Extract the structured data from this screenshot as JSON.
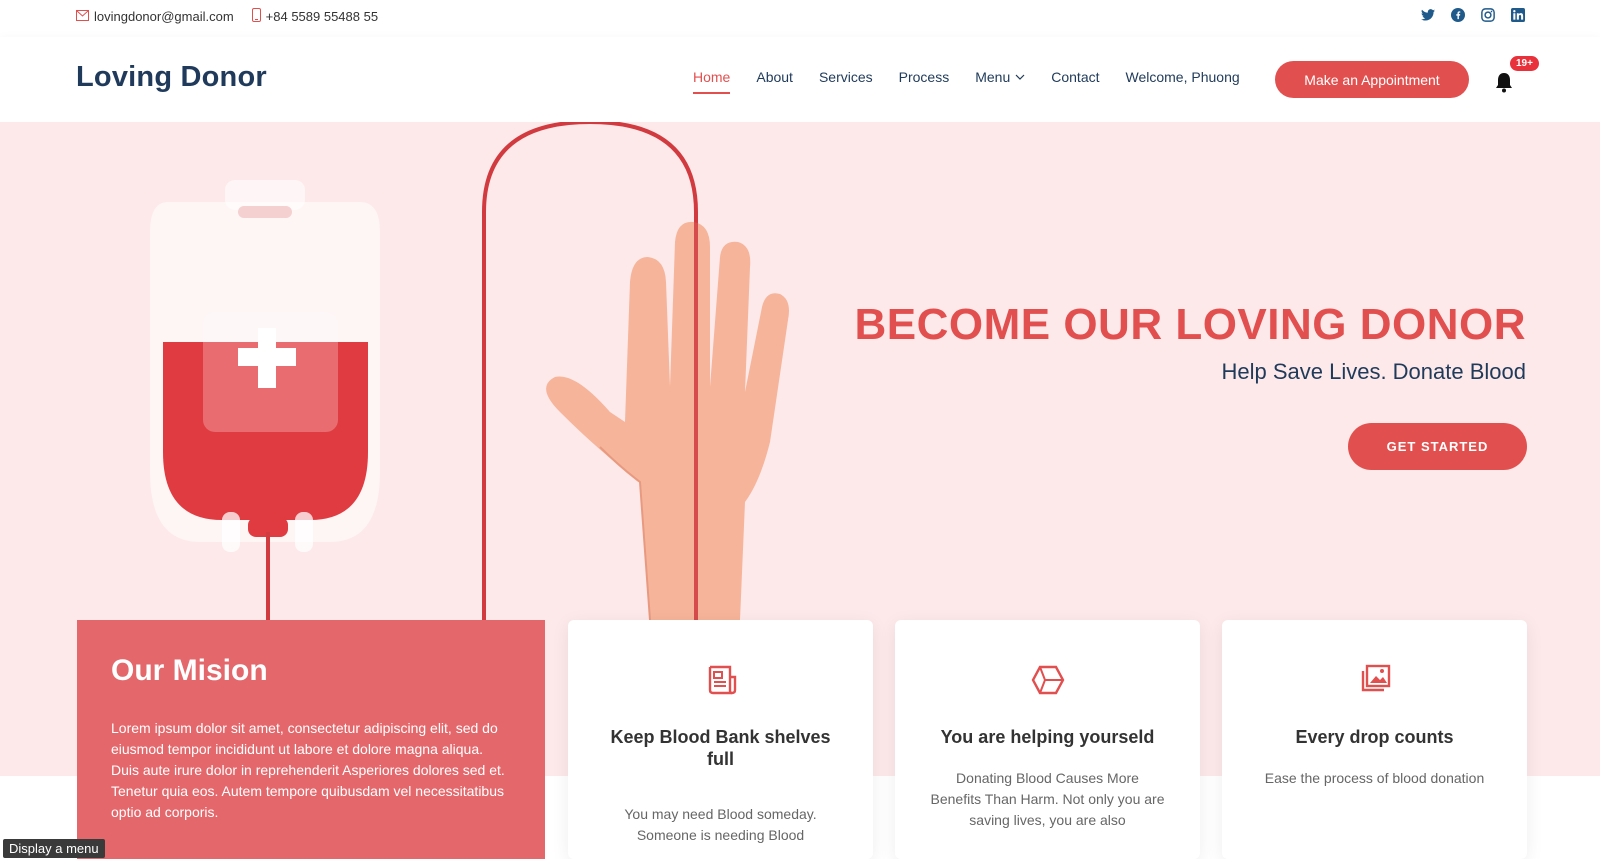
{
  "topbar": {
    "email": "lovingdonor@gmail.com",
    "phone": "+84 5589 55488 55",
    "social": [
      "twitter-icon",
      "facebook-icon",
      "instagram-icon",
      "linkedin-icon"
    ]
  },
  "header": {
    "logo": "Loving Donor",
    "nav": [
      {
        "label": "Home"
      },
      {
        "label": "About"
      },
      {
        "label": "Services"
      },
      {
        "label": "Process"
      },
      {
        "label": "Menu"
      },
      {
        "label": "Contact"
      },
      {
        "label": "Welcome, Phuong"
      }
    ],
    "appointment_label": "Make an Appointment",
    "notification_count": "19+"
  },
  "hero": {
    "title": "BECOME OUR LOVING DONOR",
    "subtitle": "Help Save Lives. Donate Blood",
    "button_label": "GET STARTED"
  },
  "mission": {
    "title": "Our Mision",
    "text": "Lorem ipsum dolor sit amet, consectetur adipiscing elit, sed do eiusmod tempor incididunt ut labore et dolore magna aliqua. Duis aute irure dolor in reprehenderit Asperiores dolores sed et. Tenetur quia eos. Autem tempore quibusdam vel necessitatibus optio ad corporis."
  },
  "cards": [
    {
      "title": "Keep Blood Bank shelves full",
      "text": "You may need Blood someday. Someone is needing Blood",
      "icon": "newspaper-icon"
    },
    {
      "title": "You are helping yourseld",
      "text": "Donating Blood Causes More Benefits Than Harm. Not only you are saving lives, you are also",
      "icon": "cube-icon"
    },
    {
      "title": "Every drop counts",
      "text": "Ease the process of blood donation",
      "icon": "images-icon"
    }
  ],
  "tooltip": "Display a menu",
  "colors": {
    "accent": "#e24f4f",
    "navy": "#1f3a5a",
    "hero_bg": "#fde9e9",
    "mission_bg": "#e4676b"
  }
}
